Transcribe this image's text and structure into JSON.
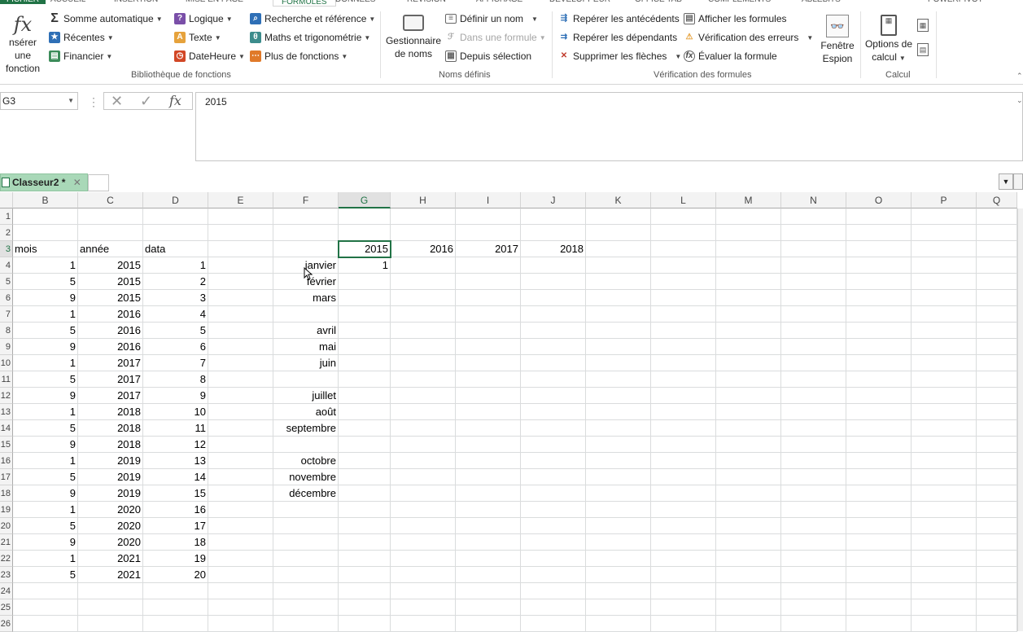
{
  "ribbon": {
    "tabs": [
      "FICHIER",
      "ACCUEIL",
      "INSERTION",
      "MISE EN PAGE",
      "FORMULES",
      "DONNÉES",
      "RÉVISION",
      "AFFICHAGE",
      "DÉVELOPPEUR",
      "OFFICE TAB",
      "COMPLÉMENTS",
      "ABLEBITS",
      "POWERPIVOT"
    ],
    "insert_function": [
      "nsérer une",
      "fonction"
    ],
    "library": {
      "autosum": "Somme automatique",
      "recent": "Récentes",
      "financial": "Financier",
      "logical": "Logique",
      "text": "Texte",
      "datetime": "DateHeure",
      "lookup": "Recherche et référence",
      "math": "Maths et trigonométrie",
      "more": "Plus de fonctions",
      "label": "Bibliothèque de fonctions"
    },
    "names": {
      "manager": [
        "Gestionnaire",
        "de noms"
      ],
      "define": "Définir un nom",
      "use_in_formula": "Dans une formule",
      "from_selection": "Depuis sélection",
      "label": "Noms définis"
    },
    "audit": {
      "precedents": "Repérer les antécédents",
      "dependents": "Repérer les dépendants",
      "remove_arrows": "Supprimer les flèches",
      "show_formulas": "Afficher les formules",
      "error_check": "Vérification des erreurs",
      "evaluate": "Évaluer la formule",
      "watch": [
        "Fenêtre",
        "Espion"
      ],
      "label": "Vérification des formules"
    },
    "calc": {
      "options": [
        "Options de",
        "calcul"
      ],
      "label": "Calcul"
    }
  },
  "namebox": "G3",
  "formula": "2015",
  "workbook_tab": "Classeur2 *",
  "columns": [
    {
      "id": "B"
    },
    {
      "id": "C"
    },
    {
      "id": "D"
    },
    {
      "id": "E"
    },
    {
      "id": "F"
    },
    {
      "id": "G"
    },
    {
      "id": "H"
    },
    {
      "id": "I"
    },
    {
      "id": "J"
    },
    {
      "id": "K"
    },
    {
      "id": "L"
    },
    {
      "id": "M"
    },
    {
      "id": "N"
    },
    {
      "id": "O"
    },
    {
      "id": "P"
    },
    {
      "id": "Q"
    }
  ],
  "rows": [
    "1",
    "2",
    "3",
    "4",
    "5",
    "6",
    "7",
    "8",
    "9",
    "10",
    "11",
    "12",
    "13",
    "14",
    "15",
    "16",
    "17",
    "18",
    "19",
    "20",
    "21",
    "22",
    "23",
    "24",
    "25",
    "26"
  ],
  "cells": {
    "3": {
      "B": "mois",
      "C": "année",
      "D": "data",
      "G": "2015",
      "H": "2016",
      "I": "2017",
      "J": "2018"
    },
    "4": {
      "B": "1",
      "C": "2015",
      "D": "1",
      "F": "janvier",
      "G": "1"
    },
    "5": {
      "B": "5",
      "C": "2015",
      "D": "2",
      "F": "février"
    },
    "6": {
      "B": "9",
      "C": "2015",
      "D": "3",
      "F": "mars"
    },
    "7": {
      "B": "1",
      "C": "2016",
      "D": "4"
    },
    "8": {
      "B": "5",
      "C": "2016",
      "D": "5",
      "F": "avril"
    },
    "9": {
      "B": "9",
      "C": "2016",
      "D": "6",
      "F": "mai"
    },
    "10": {
      "B": "1",
      "C": "2017",
      "D": "7",
      "F": "juin"
    },
    "11": {
      "B": "5",
      "C": "2017",
      "D": "8"
    },
    "12": {
      "B": "9",
      "C": "2017",
      "D": "9",
      "F": "juillet"
    },
    "13": {
      "B": "1",
      "C": "2018",
      "D": "10",
      "F": "août"
    },
    "14": {
      "B": "5",
      "C": "2018",
      "D": "11",
      "F": "septembre"
    },
    "15": {
      "B": "9",
      "C": "2018",
      "D": "12"
    },
    "16": {
      "B": "1",
      "C": "2019",
      "D": "13",
      "F": "octobre"
    },
    "17": {
      "B": "5",
      "C": "2019",
      "D": "14",
      "F": "novembre"
    },
    "18": {
      "B": "9",
      "C": "2019",
      "D": "15",
      "F": "décembre"
    },
    "19": {
      "B": "1",
      "C": "2020",
      "D": "16"
    },
    "20": {
      "B": "5",
      "C": "2020",
      "D": "17"
    },
    "21": {
      "B": "9",
      "C": "2020",
      "D": "18"
    },
    "22": {
      "B": "1",
      "C": "2021",
      "D": "19"
    },
    "23": {
      "B": "5",
      "C": "2021",
      "D": "20"
    }
  },
  "selected": {
    "col": "G",
    "row": "3"
  },
  "colors": {
    "accent": "#217346",
    "tab": "#a9d8b8"
  }
}
